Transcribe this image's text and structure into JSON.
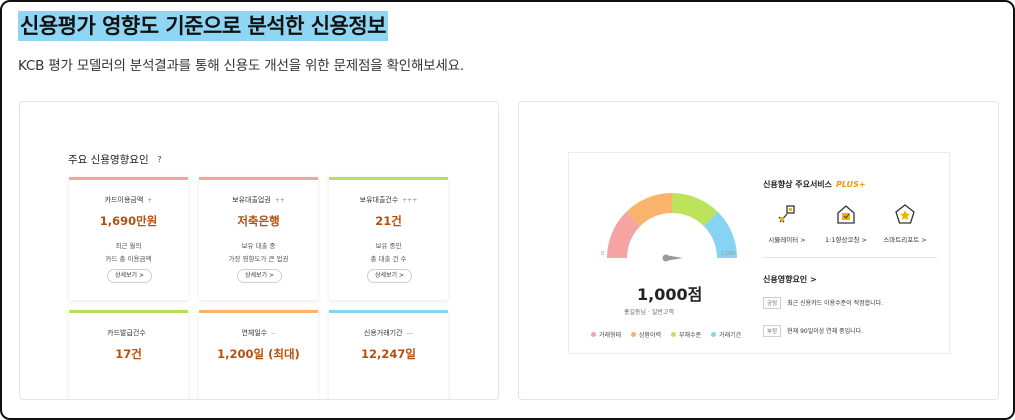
{
  "header": {
    "title": "신용평가 영향도 기준으로 분석한 신용정보",
    "subtitle": "KCB 평가 모델러의 분석결과를 통해 신용도 개선을 위한 문제점을 확인해보세요."
  },
  "left_card": {
    "section_title": "주요 신용영향요인",
    "help_icon": "question-icon",
    "factors": [
      {
        "label": "카드이용금액",
        "dots": "+",
        "value": "1,690만원",
        "desc_line1": "최근 월의",
        "desc_line2": "카드 총 이용금액",
        "button": "상세보기 >",
        "color": "#f4a3a3"
      },
      {
        "label": "보유대출업권",
        "dots": "++",
        "value": "저축은행",
        "desc_line1": "보유 대출 중",
        "desc_line2": "가장 영향도가 큰 업권",
        "button": "상세보기 >",
        "color": "#f4a3a3"
      },
      {
        "label": "보유대출건수",
        "dots": "+++",
        "value": "21건",
        "desc_line1": "보유 중인",
        "desc_line2": "총 대출 건 수",
        "button": "상세보기 >",
        "color": "#b5e05c"
      },
      {
        "label": "카드발급건수",
        "dots": "",
        "value": "17건",
        "color": "#b5e05c"
      },
      {
        "label": "연체일수",
        "dots": "--",
        "value": "1,200일 (최대)",
        "color": "#f9b36a"
      },
      {
        "label": "신용거래기간",
        "dots": "---",
        "value": "12,247일",
        "color": "#86d3f4"
      }
    ]
  },
  "right_card": {
    "gauge": {
      "min_label": "0",
      "max_label": "1,000",
      "level": 1.0,
      "segments": [
        {
          "name": "거래형태",
          "color": "#f5a3a3"
        },
        {
          "name": "상환이력",
          "color": "#f9b36a"
        },
        {
          "name": "부채수준",
          "color": "#bde35c"
        },
        {
          "name": "거래기간",
          "color": "#86d3f4"
        }
      ]
    },
    "score": "1,000점",
    "user_name": "홍길동님",
    "grade": "일반고객",
    "services_title": "신용향상 주요서비스",
    "services_plus": "PLUS+",
    "services": [
      {
        "label": "시뮬레이터 >",
        "icon": "simulator-icon"
      },
      {
        "label": "1:1향상코칭 >",
        "icon": "coaching-icon"
      },
      {
        "label": "스마트리포트 >",
        "icon": "smart-report-icon"
      }
    ],
    "influence_title": "신용영향요인 >",
    "influences": [
      {
        "tag": "긍정",
        "text": "최근 신용카드 이용수준이 적정합니다."
      },
      {
        "tag": "부정",
        "text": "현재 90일이상 연체 중입니다."
      }
    ]
  }
}
